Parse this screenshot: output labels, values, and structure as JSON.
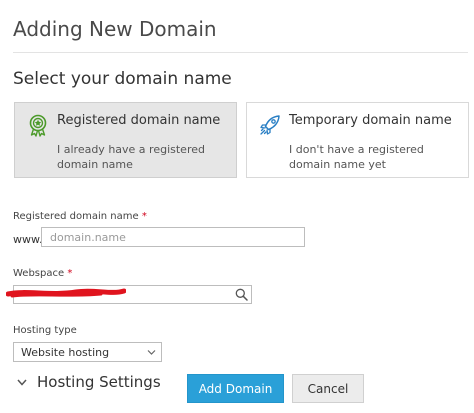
{
  "header": {
    "title": "Adding New Domain"
  },
  "domain_section": {
    "title": "Select your domain name",
    "options": [
      {
        "title": "Registered domain name",
        "description": "I already have a registered domain name",
        "icon": "award-ribbon-icon",
        "selected": true
      },
      {
        "title": "Temporary domain name",
        "description": "I don't have a registered domain name yet",
        "icon": "rocket-icon",
        "selected": false
      }
    ]
  },
  "form": {
    "domain": {
      "label": "Registered domain name",
      "required_mark": "*",
      "prefix": "www.",
      "placeholder": "domain.name"
    },
    "webspace": {
      "label": "Webspace",
      "required_mark": "*"
    },
    "hosting_type": {
      "label": "Hosting type",
      "value": "Website hosting"
    }
  },
  "hosting_settings": {
    "label": "Hosting Settings"
  },
  "actions": {
    "primary": "Add Domain",
    "secondary": "Cancel"
  },
  "colors": {
    "primary_button": "#2aa0d8",
    "selected_card": "#e6e6e6",
    "required": "#d0021b",
    "icon_green": "#4c9a2a",
    "icon_blue": "#2a7fc4",
    "redaction": "#e0141e"
  }
}
